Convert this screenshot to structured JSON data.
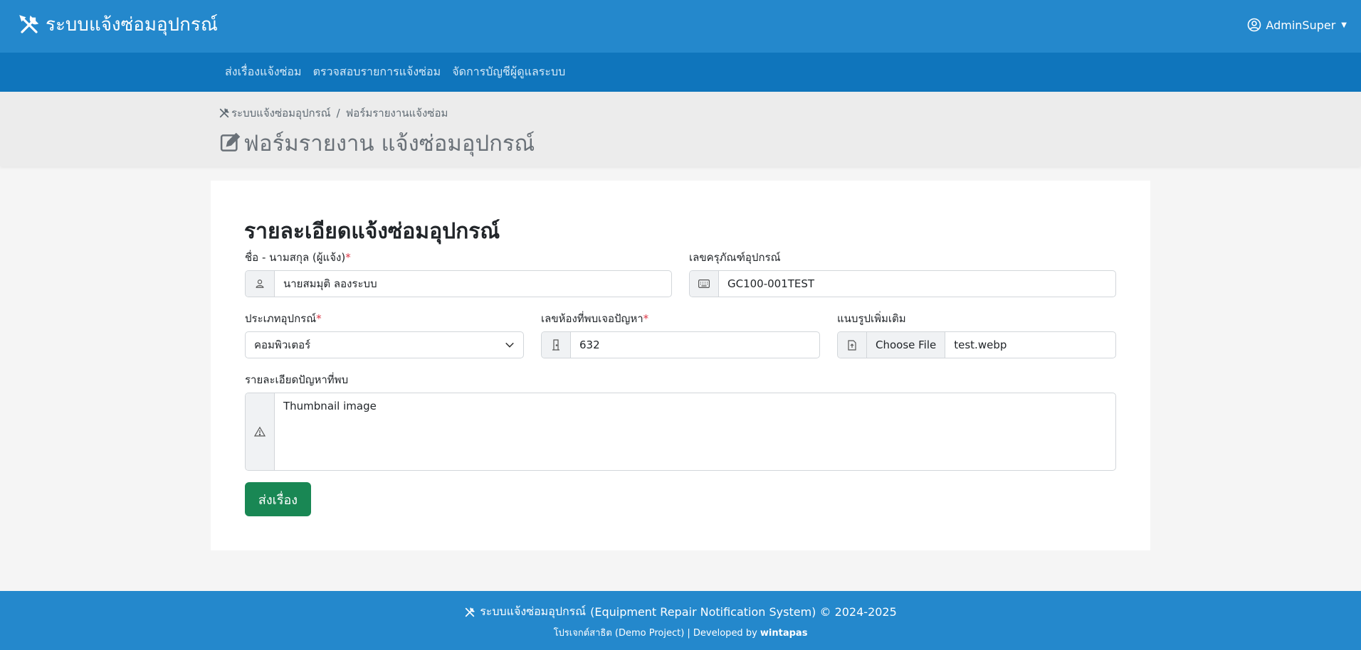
{
  "header": {
    "brand": "ระบบแจ้งซ่อมอุปกรณ์",
    "user": "AdminSuper",
    "brand_icon": "tools-icon",
    "user_icon": "user-circle-icon"
  },
  "nav": {
    "items": [
      {
        "label": "ส่งเรื่องแจ้งซ่อม"
      },
      {
        "label": "ตรวจสอบรายการแจ้งซ่อม"
      },
      {
        "label": "จัดการบัญชีผู้ดูแลระบบ"
      }
    ]
  },
  "breadcrumb": {
    "home": "ระบบแจ้งซ่อมอุปกรณ์",
    "separator": "/",
    "current": "ฟอร์มรายงานแจ้งซ่อม"
  },
  "page_title": "ฟอร์มรายงาน แจ้งซ่อมอุปกรณ์",
  "form": {
    "heading": "รายละเอียดแจ้งซ่อมอุปกรณ์",
    "required_mark": "*",
    "name_label": "ชื่อ - นามสกุล (ผู้แจ้ง)",
    "name_value": "นายสมมุติ ลองระบบ",
    "asset_label": "เลขครุภัณฑ์อุปกรณ์",
    "asset_value": "GC100-001TEST",
    "type_label": "ประเภทอุปกรณ์",
    "type_value": "คอมพิวเตอร์",
    "room_label": "เลขห้องที่พบเจอปัญหา",
    "room_value": "632",
    "file_label": "แนบรูปเพิ่มเติม",
    "file_button": "Choose File",
    "file_value": "test.webp",
    "detail_label": "รายละเอียดปัญหาที่พบ",
    "detail_value": "Thumbnail image",
    "submit_label": "ส่งเรื่อง"
  },
  "footer": {
    "line1_brand": "ระบบแจ้งซ่อมอุปกรณ์",
    "line1_rest": "(Equipment Repair Notification System) © 2024-2025",
    "line2_prefix": "โปรเจกต์สาธิต (Demo Project) | Developed by",
    "line2_author": "wintapas"
  },
  "colors": {
    "header": "#2488cc",
    "nav": "#0f75bc",
    "submit": "#198754",
    "required": "#dc3545"
  }
}
